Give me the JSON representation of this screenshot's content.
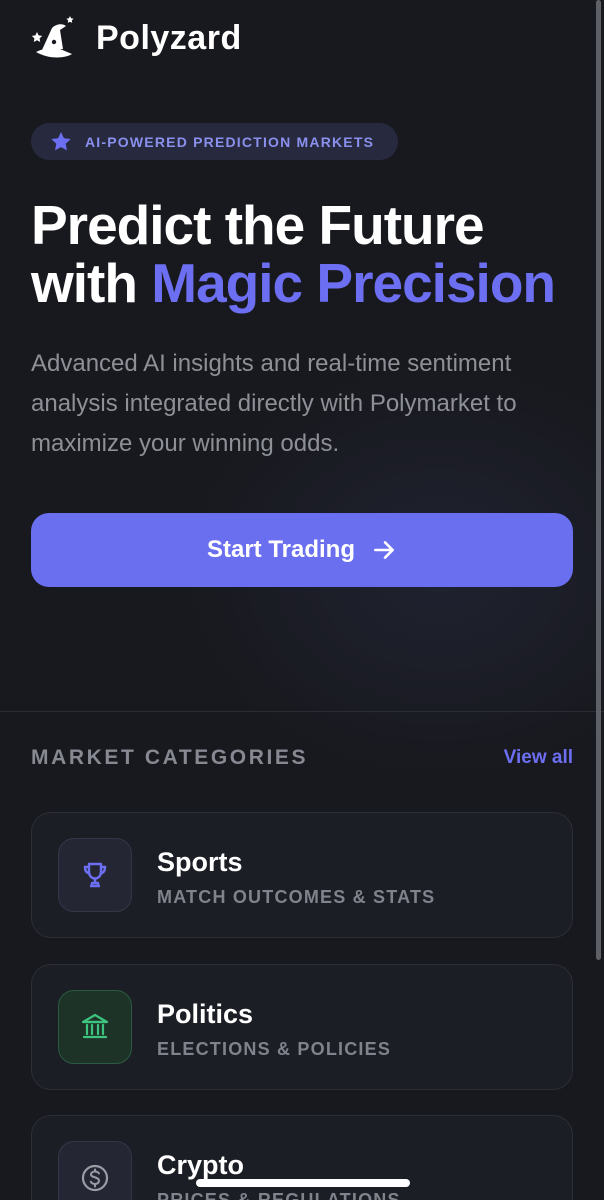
{
  "header": {
    "brand": "Polyzard",
    "logo_icon": "wizard-hat-icon"
  },
  "hero": {
    "badge": {
      "icon": "star-icon",
      "label": "AI-POWERED PREDICTION MARKETS"
    },
    "headline_line1": "Predict the Future",
    "headline_line2_prefix": "with ",
    "headline_line2_accent": "Magic Precision",
    "description": "Advanced AI insights and real-time sentiment analysis integrated directly with Polymarket to maximize your winning odds.",
    "cta": {
      "label": "Start Trading",
      "icon": "arrow-right-icon"
    }
  },
  "categories": {
    "title": "MARKET CATEGORIES",
    "view_all": "View all",
    "items": [
      {
        "title": "Sports",
        "subtitle": "MATCH OUTCOMES & STATS",
        "icon": "trophy-icon",
        "icon_color": "#6d6ff2"
      },
      {
        "title": "Politics",
        "subtitle": "ELECTIONS & POLICIES",
        "icon": "government-building-icon",
        "icon_color": "#3ec47e"
      },
      {
        "title": "Crypto",
        "subtitle": "PRICES & REGULATIONS",
        "icon": "dollar-coin-icon",
        "icon_color": "#9a9ca6"
      }
    ]
  },
  "colors": {
    "accent": "#6d6ff2",
    "background": "#18191e",
    "card": "#1c1e26"
  }
}
